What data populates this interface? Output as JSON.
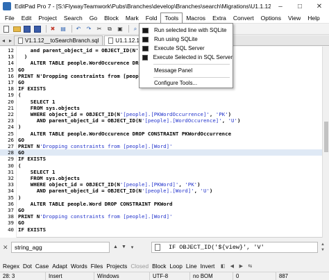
{
  "window": {
    "title": "EditPad Pro 7 - [S:\\FlywayTeamwork\\Pubs\\Branches\\develop\\Branches\\search\\Migrations\\U1.1.12.1_...",
    "minimize": "–",
    "maximize": "□",
    "close": "✕"
  },
  "menubar": {
    "items": [
      "File",
      "Edit",
      "Project",
      "Search",
      "Go",
      "Block",
      "Mark",
      "Fold",
      "Tools",
      "Macros",
      "Extra",
      "Convert",
      "Options",
      "View",
      "Help"
    ]
  },
  "tabs": {
    "items": [
      "V1.1.12__toSearchBranch.sql",
      "U1.1.12.1__Search_Funct"
    ],
    "active_index": 1
  },
  "tools_menu": {
    "items": [
      {
        "label": "Run selected line with SQLite",
        "icon": "console-icon"
      },
      {
        "label": "Run using SQLite",
        "icon": "console-icon"
      },
      {
        "label": "Execute SQL Server",
        "icon": "console-icon"
      },
      {
        "label": "Execute Selected in SQL Server",
        "icon": "console-icon"
      },
      {
        "label": "Message Panel",
        "icon": ""
      },
      {
        "label": "Configure Tools...",
        "icon": ""
      }
    ]
  },
  "editor": {
    "current_line": "28",
    "lines": [
      {
        "n": "12",
        "text": "    and parent_object_id = OBJECT_ID(N'[people].[WordOccurence]"
      },
      {
        "n": "13",
        "text": "  )"
      },
      {
        "n": "14",
        "text": "    ALTER TABLE people.WordOccurence DROP"
      },
      {
        "n": "15",
        "text": "GO"
      },
      {
        "n": "16",
        "text": "PRINT N'Dropping constraints from [people]."
      },
      {
        "n": "17",
        "text": "GO"
      },
      {
        "n": "18",
        "text": "IF EXISTS"
      },
      {
        "n": "19",
        "text": "("
      },
      {
        "n": "20",
        "text": "    SELECT 1"
      },
      {
        "n": "21",
        "text": "    FROM sys.objects"
      },
      {
        "n": "22",
        "text": "    WHERE object_id = OBJECT_ID(N'[people].[PKWordOccurrence]', 'PK')"
      },
      {
        "n": "23",
        "text": "      AND parent_object_id = OBJECT_ID(N'[people].[WordOccurence]', 'U')"
      },
      {
        "n": "24",
        "text": ")"
      },
      {
        "n": "25",
        "text": "    ALTER TABLE people.WordOccurence DROP CONSTRAINT PKWordOccurrence"
      },
      {
        "n": "26",
        "text": "GO"
      },
      {
        "n": "27",
        "text": "PRINT N'Dropping constraints from [people].[Word]'"
      },
      {
        "n": "28",
        "text": "GO"
      },
      {
        "n": "29",
        "text": "IF EXISTS"
      },
      {
        "n": "30",
        "text": "("
      },
      {
        "n": "31",
        "text": "    SELECT 1"
      },
      {
        "n": "32",
        "text": "    FROM sys.objects"
      },
      {
        "n": "33",
        "text": "    WHERE object_id = OBJECT_ID(N'[people].[PKWord]', 'PK')"
      },
      {
        "n": "34",
        "text": "      AND parent_object_id = OBJECT_ID(N'[people].[Word]', 'U')"
      },
      {
        "n": "35",
        "text": ")"
      },
      {
        "n": "36",
        "text": "    ALTER TABLE people.Word DROP CONSTRAINT PKWord"
      },
      {
        "n": "37",
        "text": "GO"
      },
      {
        "n": "38",
        "text": "PRINT N'Dropping constraints from [people].[Word]'"
      },
      {
        "n": "39",
        "text": "GO"
      },
      {
        "n": "40",
        "text": "IF EXISTS"
      }
    ]
  },
  "search": {
    "find_value": "string_agg",
    "replace_value": "IF OBJECT_ID('${view}', 'V'"
  },
  "options": {
    "items": [
      {
        "label": "Regex",
        "enabled": true
      },
      {
        "label": "Dot",
        "enabled": true
      },
      {
        "label": "Case",
        "enabled": true
      },
      {
        "label": "Adapt",
        "enabled": true
      },
      {
        "label": "Words",
        "enabled": true
      },
      {
        "label": "Files",
        "enabled": true
      },
      {
        "label": "Projects",
        "enabled": true
      },
      {
        "label": "Closed",
        "enabled": false
      },
      {
        "label": "Block",
        "enabled": true
      },
      {
        "label": "Loop",
        "enabled": true
      },
      {
        "label": "Line",
        "enabled": true
      },
      {
        "label": "Invert",
        "enabled": true
      }
    ]
  },
  "status": {
    "position": "28: 3",
    "mode": "Insert",
    "line_break": "Windows",
    "encoding": "UTF-8",
    "bom": "no BOM",
    "selection": "0",
    "length": "887"
  },
  "colors": {
    "current_line": "#dfe9f5",
    "string_blue": "#2233cc",
    "menu_border": "#888888"
  }
}
